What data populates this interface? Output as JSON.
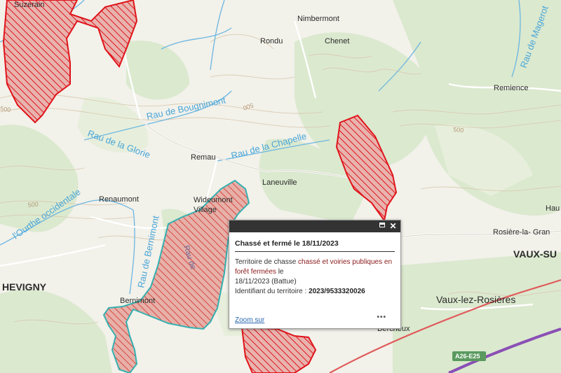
{
  "map": {
    "places": {
      "suzerain": "Suzerain",
      "nimbermont": "Nimbermont",
      "rondu": "Rondu",
      "chenet": "Chenet",
      "remience": "Remience",
      "remau": "Remau",
      "laneuville": "Laneuville",
      "renaumont": "Renaumont",
      "wideumont_1": "Wideumont",
      "wideumont_2": "Village",
      "rosiere": "Rosière-la- Gran",
      "haut": "Hau",
      "hevigny": "HEVIGNY",
      "vaux_su": "VAUX-SU",
      "vaux_les_rosieres": "Vaux-lez-Rosières",
      "bernimont": "Bernimont",
      "bercheux": "Bercheux"
    },
    "rivers": {
      "bougnimont": "Rau de Bougnimont",
      "glorie": "Rau de la Glorie",
      "chapelle": "Rau de la Chapelle",
      "ourthe": "l'Ourthe occidentale",
      "bernimont": "Rau de Bernimont",
      "magerotte": "Rau de Magerot",
      "rau_de": "Rau de"
    },
    "contours": {
      "c500_a": "500",
      "c500_b": "500",
      "c500_c": "500",
      "c500_d": "500"
    },
    "road_badge": "A26-E25",
    "colors": {
      "hunting_zone": "#e0141a",
      "selected_zone": "#36b0b0",
      "water": "#4aa6d8",
      "motorway": "#8a4fb5"
    }
  },
  "popup": {
    "title": "Chassé et fermé le 18/11/2023",
    "line1_prefix": "Territoire de chasse",
    "line1_highlight": "chassé et voiries publiques en forêt fermées",
    "line1_suffix": "le",
    "date_line": "18/11/2023 (Battue)",
    "id_label": "Identifiant du territoire :",
    "id_value": "2023/9533320026",
    "zoom_link": "Zoom sur",
    "more": "•••"
  }
}
